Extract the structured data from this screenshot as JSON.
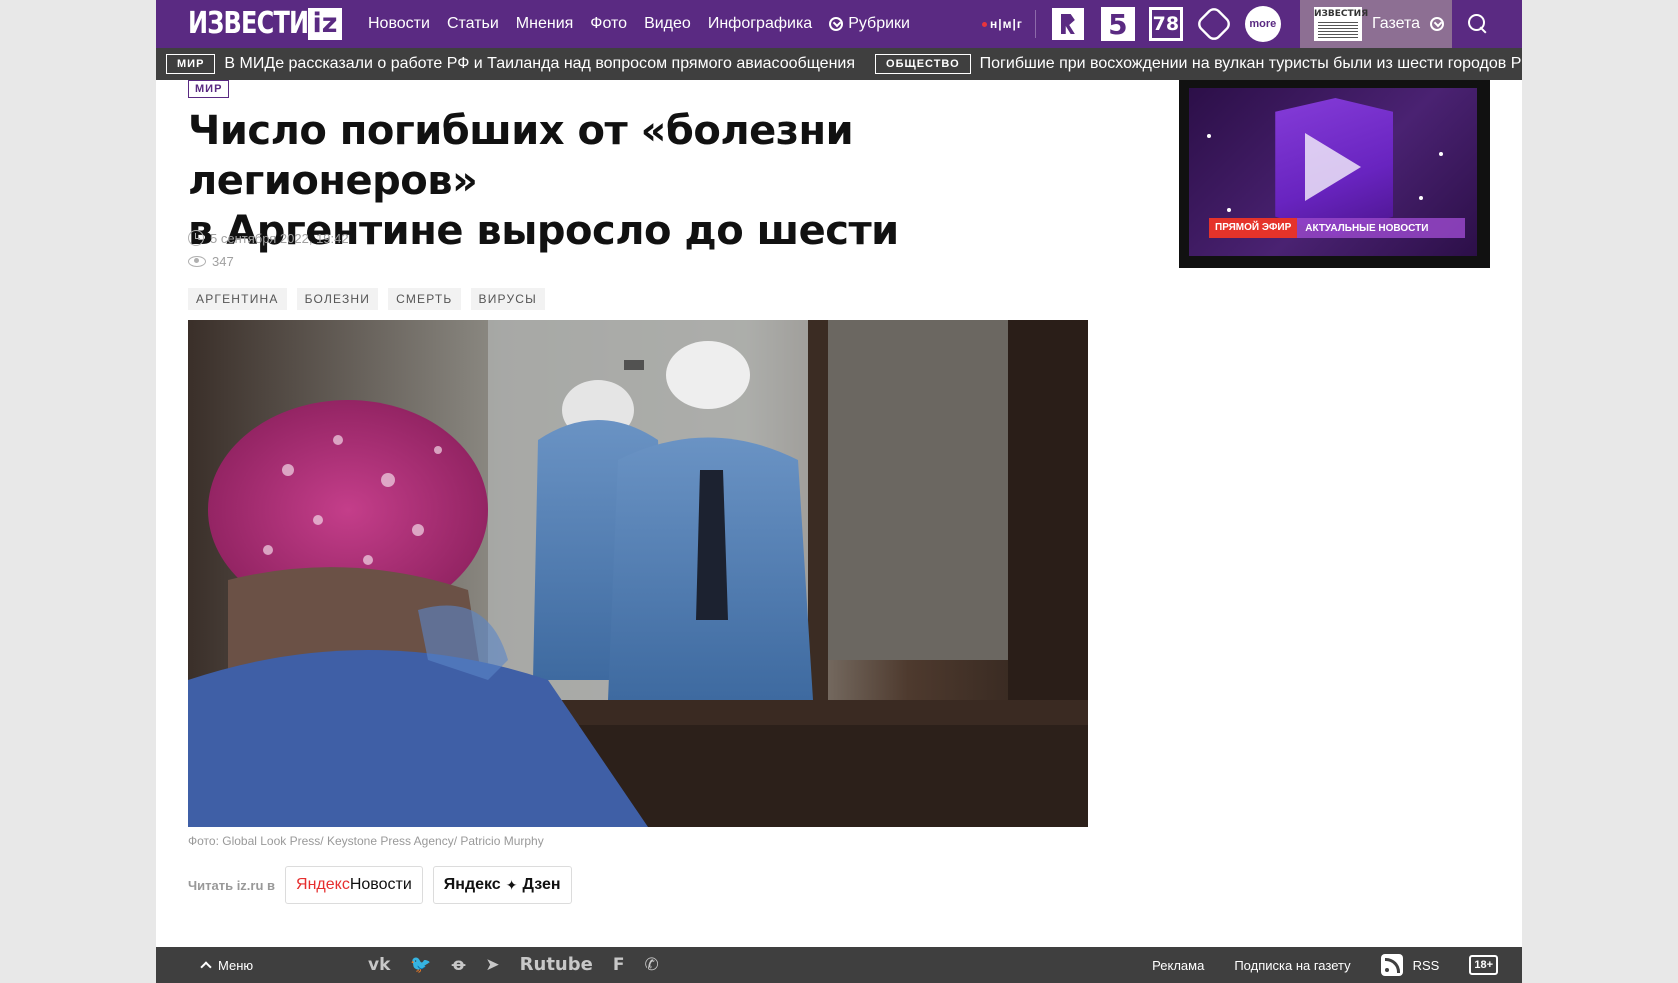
{
  "header": {
    "logo_text": "ИЗВЕСТИЯ",
    "logo_badge": "iz",
    "nav": [
      "Новости",
      "Статьи",
      "Мнения",
      "Фото",
      "Видео",
      "Инфографика",
      "Рубрики"
    ],
    "nmg_label": "н|м|г",
    "channels": {
      "ch5": "5",
      "ch78": "78",
      "more": "more"
    },
    "gazeta_logo": "ИЗВЕСТИЯ",
    "gazeta_label": "Газета"
  },
  "ticker": [
    {
      "tag": "МИР",
      "text": "В МИДе рассказали о работе РФ и Таиланда над вопросом прямого авиасообщения"
    },
    {
      "tag": "ОБЩЕСТВО",
      "text": "Погибшие при восхождении на вулкан туристы были из шести городов Р"
    }
  ],
  "article": {
    "rubric": "МИР",
    "title_line1": "Число погибших от «болезни легионеров»",
    "title_line2": "в Аргентине выросло до шести",
    "date": "5 сентября 2022, 19:42",
    "views": "347",
    "tags": [
      "АРГЕНТИНА",
      "БОЛЕЗНИ",
      "СМЕРТЬ",
      "ВИРУСЫ"
    ],
    "caption": "Фото: Global Look Press/ Keystone Press Agency/ Patricio Murphy",
    "read_in_label": "Читать iz.ru в",
    "yandex_news": {
      "part1": "Яндекс",
      "part2": "Новости"
    },
    "yandex_dzen": {
      "part1": "Яндекс",
      "star": "✦",
      "part2": "Дзен"
    }
  },
  "video": {
    "live_label": "ПРЯМОЙ ЭФИР",
    "news_label": "АКТУАЛЬНЫЕ НОВОСТИ"
  },
  "footer": {
    "menu_label": "Меню",
    "socials": [
      "vk",
      "twitter",
      "odnoklassniki",
      "telegram",
      "Rutube",
      "flipboard",
      "viber"
    ],
    "rutube_label": "Rutube",
    "ads_label": "Реклама",
    "subscribe_label": "Подписка на газету",
    "rss_label": "RSS",
    "age_label": "18+"
  },
  "colors": {
    "brand": "#5a2a82",
    "ticker_bg": "#3f3f3f",
    "live_red": "#e5332a"
  }
}
